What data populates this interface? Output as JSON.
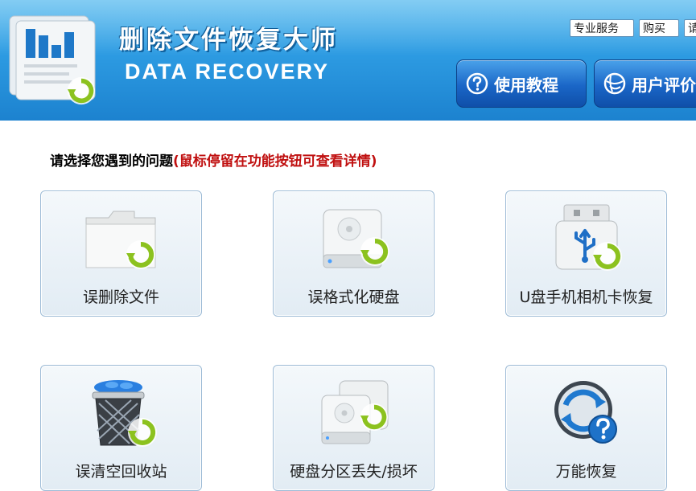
{
  "header": {
    "title": "删除文件恢复大师",
    "subtitle": "DATA RECOVERY",
    "links": {
      "service": "专业服务",
      "buy": "购买",
      "extra": "请"
    },
    "buttons": {
      "tutorial": "使用教程",
      "review": "用户评价"
    }
  },
  "prompt": {
    "text": "请选择您遇到的问题",
    "hint": "(鼠标停留在功能按钮可查看详情)"
  },
  "cards": [
    {
      "label": "误删除文件",
      "icon": "folder-icon"
    },
    {
      "label": "误格式化硬盘",
      "icon": "hard-drive-icon"
    },
    {
      "label": "U盘手机相机卡恢复",
      "icon": "usb-drive-icon"
    },
    {
      "label": "误清空回收站",
      "icon": "recycle-bin-icon"
    },
    {
      "label": "硬盘分区丢失/损坏",
      "icon": "hard-drives-icon"
    },
    {
      "label": "万能恢复",
      "icon": "universal-recovery-icon"
    }
  ],
  "colors": {
    "header_blue": "#2d9be2",
    "button_blue": "#1a66c7",
    "hint_red": "#c01010",
    "recover_green": "#8cc21f"
  }
}
